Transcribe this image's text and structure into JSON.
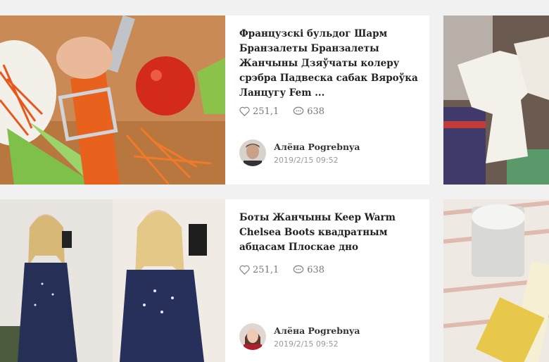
{
  "posts": [
    {
      "title": "Французскі бульдог Шарм Бранзалеты Бранзалеты Жанчыны Дзяўчаты колеру срэбра Падвеска сабак Вяроўка Ланцугу Fem ...",
      "likes": "251,1",
      "comments": "638",
      "author": "Алёна Pogrebnya",
      "date": "2019/2/15 09:52"
    },
    {
      "title": "Боты Жанчыны Keep Warm Chelsea Boots квадратным абцасам Плоскае дно",
      "likes": "251,1",
      "comments": "638",
      "author": "Алёна Pogrebnya",
      "date": "2019/2/15 09:52"
    }
  ]
}
